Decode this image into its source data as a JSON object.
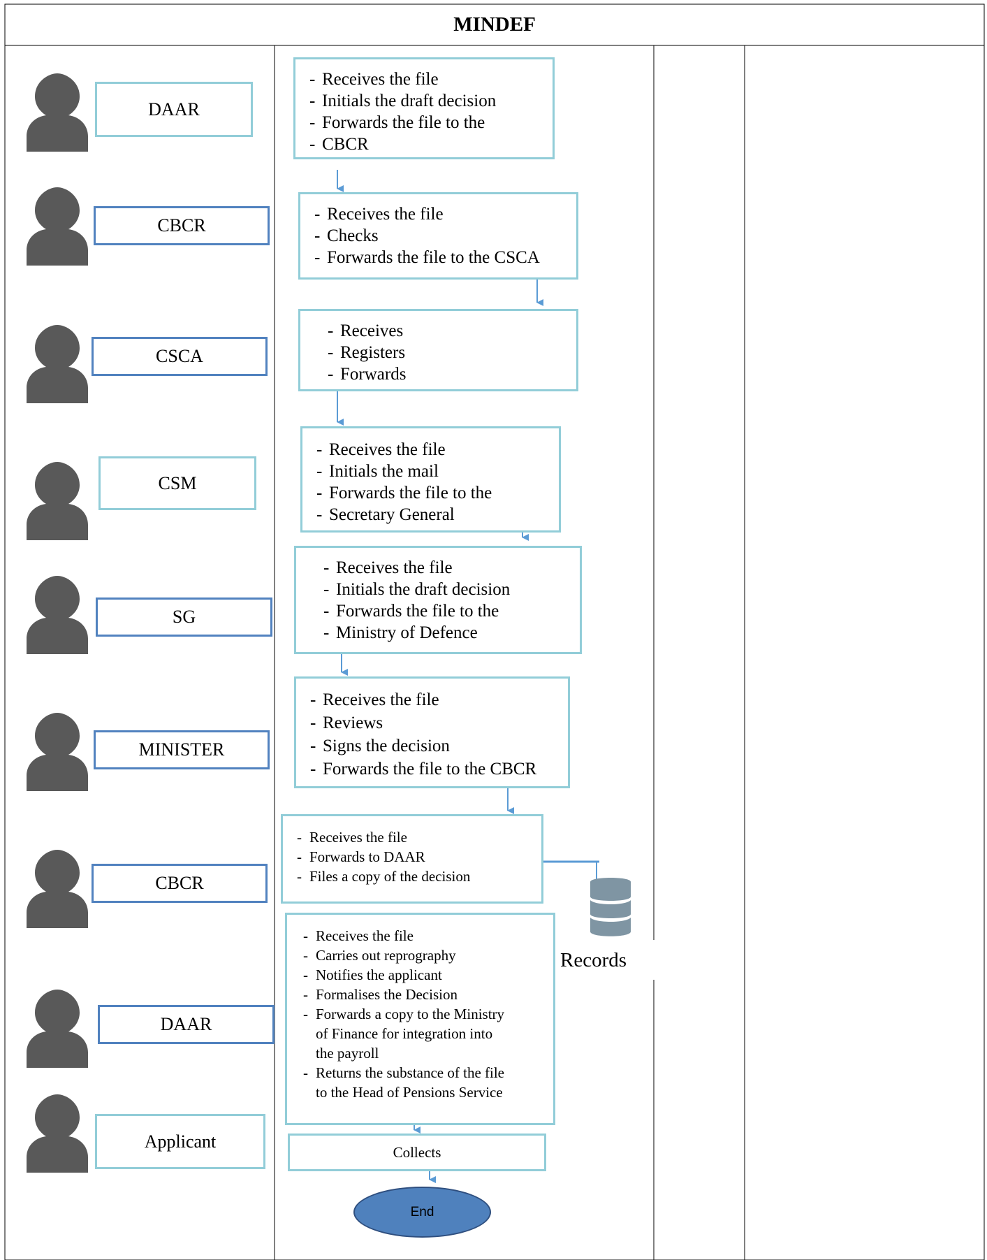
{
  "header": {
    "title": "MINDEF"
  },
  "actors": [
    {
      "label": "DAAR"
    },
    {
      "label": "CBCR"
    },
    {
      "label": "CSCA"
    },
    {
      "label": "CSM"
    },
    {
      "label": "SG"
    },
    {
      "label": "MINISTER"
    },
    {
      "label": "CBCR"
    },
    {
      "label": "DAAR"
    },
    {
      "label": "Applicant"
    }
  ],
  "steps": [
    {
      "lines": [
        "Receives the file",
        "Initials the draft decision",
        "Forwards the file to the",
        "CBCR"
      ]
    },
    {
      "lines": [
        "Receives the file",
        "Checks",
        "Forwards the file to the CSCA"
      ]
    },
    {
      "lines": [
        "Receives",
        "Registers",
        "Forwards"
      ]
    },
    {
      "lines": [
        "Receives the file",
        "Initials the mail",
        "Forwards the file to the",
        "Secretary General"
      ]
    },
    {
      "lines": [
        "Receives the file",
        "Initials the draft decision",
        "Forwards the file to the",
        "Ministry of Defence"
      ]
    },
    {
      "lines": [
        "Receives the file",
        "Reviews",
        "Signs the decision",
        "Forwards the file to the CBCR"
      ]
    },
    {
      "lines": [
        "Receives the file",
        "Forwards to DAAR",
        "Files a copy of the decision"
      ]
    },
    {
      "lines": [
        "Receives the file",
        "Carries out reprography",
        "Notifies the applicant",
        "Formalises the Decision",
        "Forwards a copy to the Ministry",
        "of Finance for integration into",
        "the payroll",
        "Returns the substance of the file",
        "to the Head of Pensions Service"
      ]
    }
  ],
  "collects": {
    "label": "Collects"
  },
  "end": {
    "label": "End"
  },
  "records": {
    "label": "Records",
    "icon": "database-icon"
  },
  "colors": {
    "light_border": "#92cdd8",
    "dark_border": "#5182bf",
    "arrow": "#5b9bd5",
    "person": "#595959",
    "end_fill": "#4f81bd",
    "database": "#7f95a3"
  }
}
